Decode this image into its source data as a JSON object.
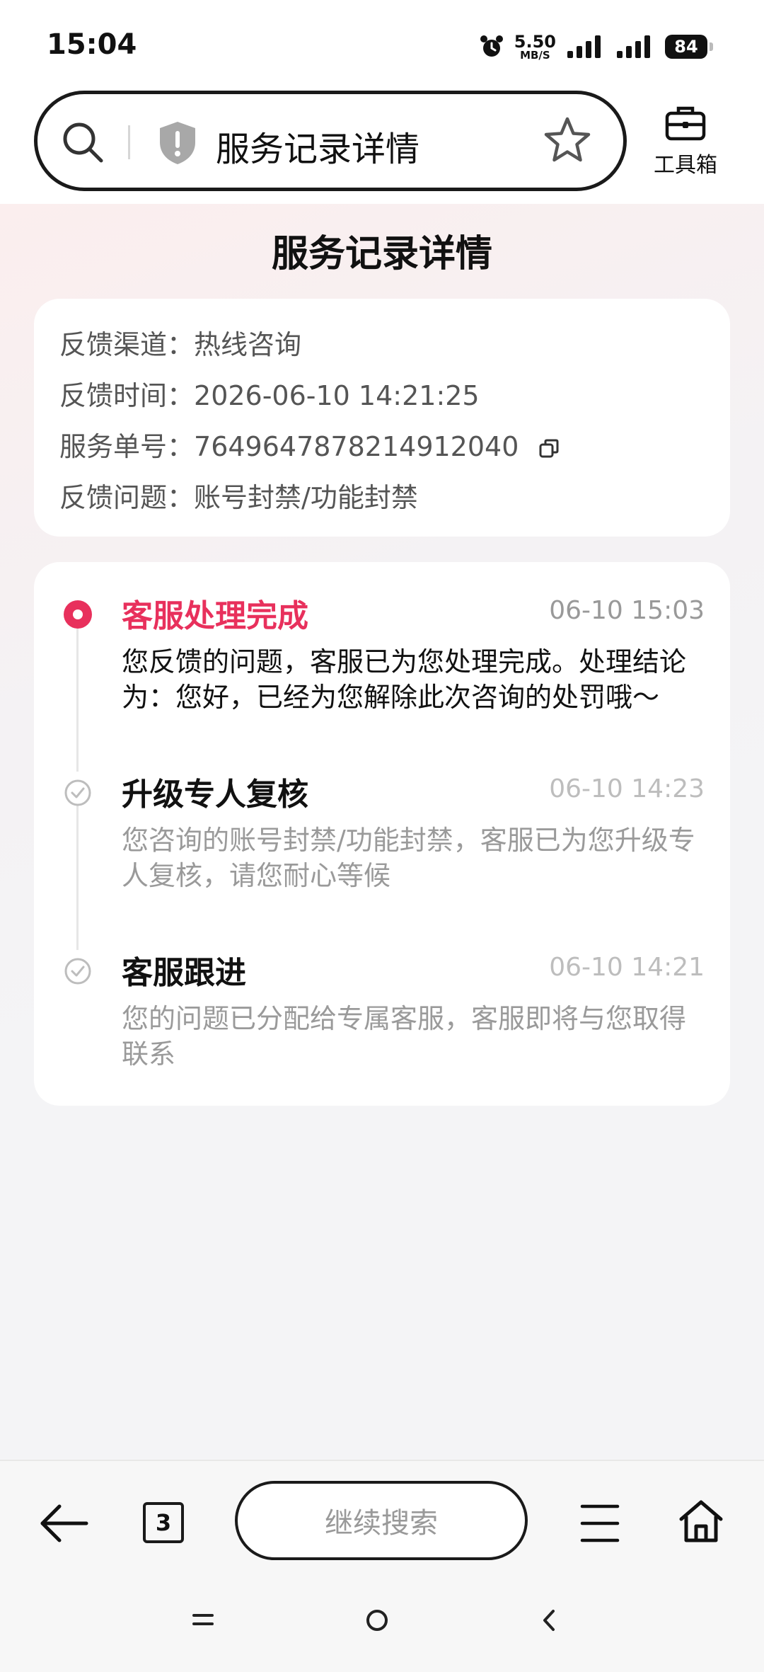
{
  "status_bar": {
    "time": "15:04",
    "net_speed_value": "5.50",
    "net_speed_unit": "MB/S",
    "battery": "84"
  },
  "search": {
    "text": "服务记录详情",
    "toolbox_label": "工具箱"
  },
  "page": {
    "title": "服务记录详情"
  },
  "info": {
    "rows": [
      {
        "key": "反馈渠道：",
        "value": "热线咨询"
      },
      {
        "key": "反馈时间：",
        "value": "2026-06-10 14:21:25"
      },
      {
        "key": "服务单号：",
        "value": "7649647878214912040"
      },
      {
        "key": "反馈问题：",
        "value": "账号封禁/功能封禁"
      }
    ]
  },
  "timeline": [
    {
      "title": "客服处理完成",
      "time": "06-10 15:03",
      "desc": "您反馈的问题，客服已为您处理完成。处理结论为：您好，已经为您解除此次咨询的处罚哦～",
      "status": "active"
    },
    {
      "title": "升级专人复核",
      "time": "06-10 14:23",
      "desc": "您咨询的账号封禁/功能封禁，客服已为您升级专人复核，请您耐心等候",
      "status": "done"
    },
    {
      "title": "客服跟进",
      "time": "06-10 14:21",
      "desc": "您的问题已分配给专属客服，客服即将与您取得联系",
      "status": "done"
    }
  ],
  "bottom_bar": {
    "tab_count": "3",
    "continue_search": "继续搜索"
  },
  "colors": {
    "accent": "#e8305c",
    "muted_text": "#9a9a9a"
  }
}
